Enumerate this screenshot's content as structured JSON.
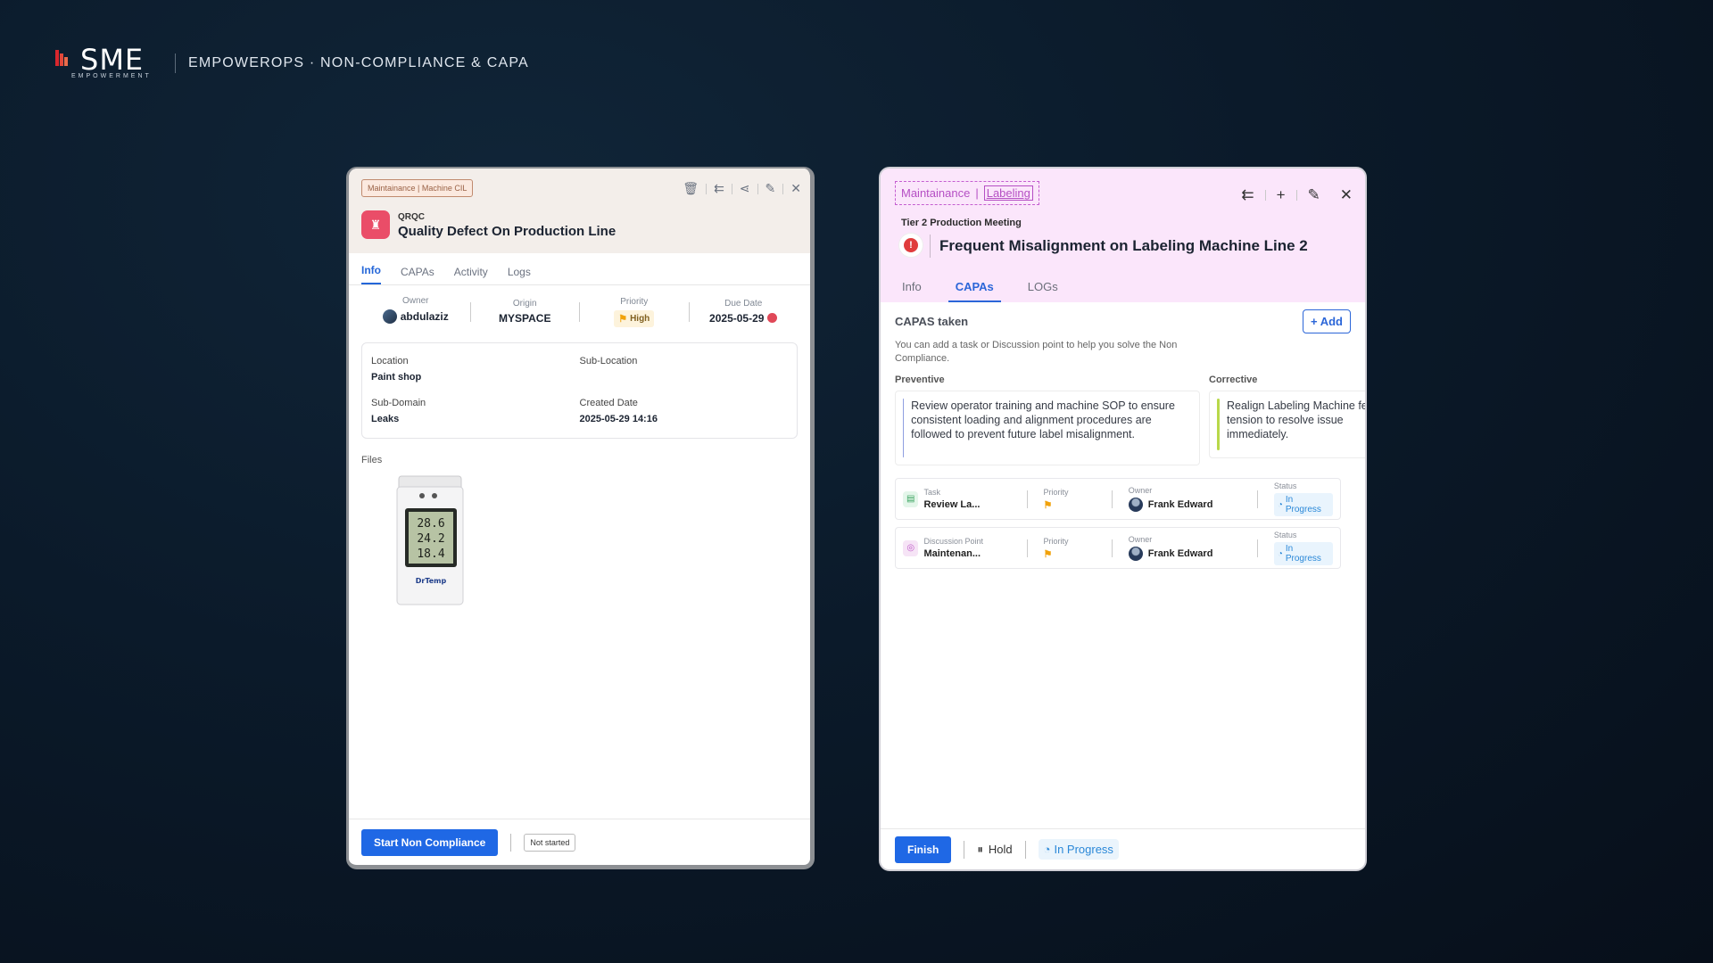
{
  "brand": {
    "logo_text": "SME",
    "logo_sub": "EMPOWERMENT",
    "title": "EMPOWEROPS · NON-COMPLIANCE & CAPA"
  },
  "panel_a": {
    "tag": "Maintainance | Machine CIL",
    "eyebrow": "QRQC",
    "title": "Quality Defect On Production Line",
    "tabs": [
      "Info",
      "CAPAs",
      "Activity",
      "Logs"
    ],
    "active_tab": "Info",
    "meta": {
      "owner_label": "Owner",
      "owner": "abdulaziz",
      "origin_label": "Origin",
      "origin": "MYSPACE",
      "priority_label": "Priority",
      "priority": "High",
      "due_label": "Due Date",
      "due": "2025-05-29"
    },
    "info": {
      "location_label": "Location",
      "location": "Paint shop",
      "sublocation_label": "Sub-Location",
      "sublocation": "",
      "subdomain_label": "Sub-Domain",
      "subdomain": "Leaks",
      "created_label": "Created Date",
      "created": "2025-05-29 14:16"
    },
    "files_label": "Files",
    "thermo": {
      "line1": "28.6",
      "line2": "24.2",
      "line3": "18.4",
      "brand": "DrTemp"
    },
    "footer": {
      "start_label": "Start Non Compliance",
      "status": "Not started"
    },
    "colors": {
      "accent": "#1f68e5",
      "icon_bg": "#ea4d68"
    }
  },
  "panel_b": {
    "tag_domain": "Maintainance",
    "tag_sub": "Labeling",
    "eyebrow": "Tier 2 Production Meeting",
    "title": "Frequent Misalignment on Labeling Machine Line 2",
    "tabs": [
      "Info",
      "CAPAs",
      "LOGs"
    ],
    "active_tab": "CAPAs",
    "caps_title": "CAPAS taken",
    "add_label": "+ Add",
    "caps_desc": "You can add a task or Discussion point to help you solve  the Non Compliance.",
    "preventive_label": "Preventive",
    "preventive_text": "Review operator training and machine SOP to ensure consistent loading and alignment procedures are followed to prevent future label misalignment.",
    "corrective_label": "Corrective",
    "corrective_text": "Realign Labeling Machine feeder tension to resolve issue immediately.",
    "tasks": [
      {
        "type_label": "Task",
        "name": "Review La...",
        "priority_label": "Priority",
        "owner_label": "Owner",
        "owner": "Frank Edward",
        "status_label": "Status",
        "status": "In Progress"
      },
      {
        "type_label": "Discussion Point",
        "name": "Maintenan...",
        "priority_label": "Priority",
        "owner_label": "Owner",
        "owner": "Frank Edward",
        "status_label": "Status",
        "status": "In Progress"
      }
    ],
    "footer": {
      "finish_label": "Finish",
      "hold_label": "Hold",
      "status": "In Progress"
    },
    "colors": {
      "header_bg": "#fbe6fb",
      "preventive_bar": "#8f9fe0",
      "corrective_bar": "#b8d84a"
    }
  }
}
